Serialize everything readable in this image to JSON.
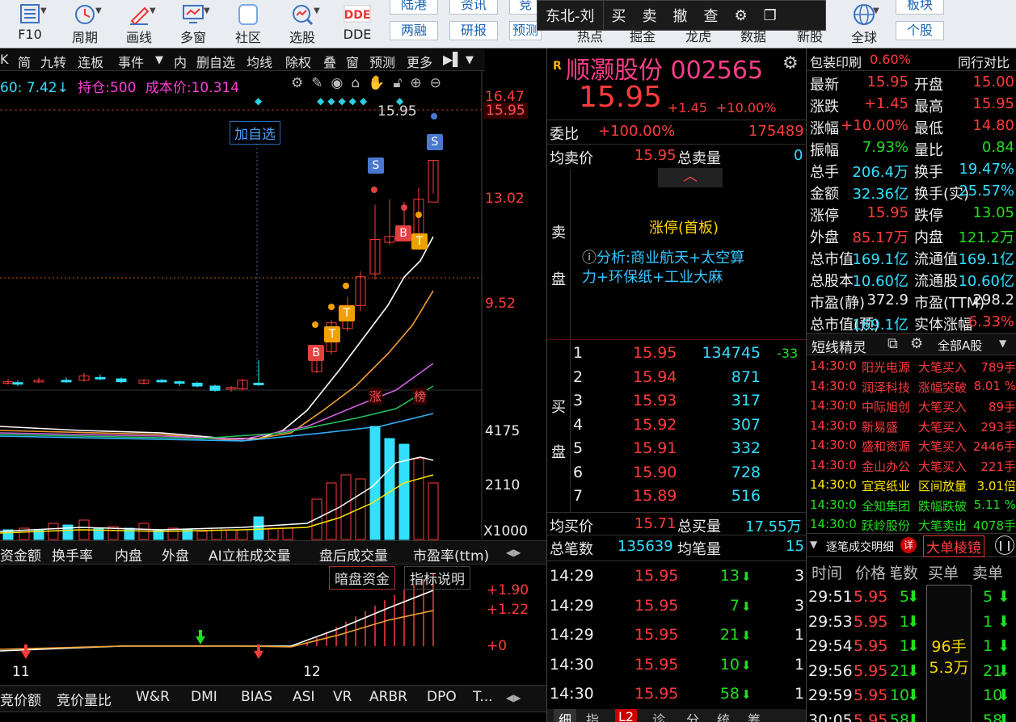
{
  "toolbar": {
    "buttons": [
      {
        "label": "F10",
        "icon": "f10-icon"
      },
      {
        "label": "周期",
        "icon": "clock-icon"
      },
      {
        "label": "画线",
        "icon": "pencil-icon"
      },
      {
        "label": "多窗",
        "icon": "monitor-icon"
      },
      {
        "label": "社区",
        "icon": "community-icon"
      },
      {
        "label": "选股",
        "icon": "stock-search-icon"
      },
      {
        "label": "DDE",
        "icon": "dde-icon"
      }
    ],
    "small_buttons": [
      "陆港",
      "资讯",
      "竞",
      "两融",
      "研报",
      "预测"
    ],
    "right_labels": [
      "热点",
      "掘金",
      "龙虎",
      "数据",
      "新股"
    ],
    "globe_label": "全球",
    "right_small": [
      "板块",
      "个股"
    ],
    "popup": {
      "account": "东北-刘",
      "buy": "买",
      "sell": "卖",
      "cancel": "撤",
      "query": "查"
    }
  },
  "left_menu": [
    "K",
    "简",
    "九转",
    "连板",
    "事件",
    "▼",
    "内",
    "删自选",
    "均线",
    "除权",
    "叠",
    "窗",
    "预测",
    "更多"
  ],
  "kline": {
    "ma_label": "60: 7.42↓",
    "position_label": "持仓:500",
    "cost_label": "成本价:10.314",
    "y_ticks": [
      "16.47",
      "15.95",
      "13.02",
      "9.52"
    ],
    "last_price": "15.95",
    "add_watch": "加自选",
    "markers": {
      "buy": "B",
      "sell": "S",
      "t": "T"
    },
    "tags": [
      "涨",
      "榜"
    ]
  },
  "volume": {
    "y_ticks": [
      "4175",
      "2110",
      "X1000"
    ],
    "bars_red": [
      120,
      105,
      140,
      125,
      110,
      95,
      115,
      120,
      135,
      90,
      75,
      100,
      85,
      70,
      145,
      80,
      92,
      90,
      90,
      130,
      330,
      330,
      415,
      425,
      440,
      450
    ],
    "bars_cyan": [
      0,
      0,
      0,
      0,
      0,
      0,
      0,
      0,
      0,
      0,
      0,
      0,
      0,
      0,
      0,
      0,
      0,
      0,
      0,
      0,
      0,
      0,
      0,
      0,
      0,
      0
    ]
  },
  "indicator_tabs": [
    "资金额",
    "换手率",
    "内盘",
    "外盘",
    "AI立桩成交量",
    "盘后成交量",
    "市盈率(ttm)"
  ],
  "lower": {
    "buttons": [
      "暗盘资金",
      "指标说明"
    ],
    "y_ticks": [
      "+1.90",
      "+1.22",
      "+0"
    ],
    "x_labels": [
      "11",
      "12"
    ]
  },
  "bottom_tabs": [
    "竞价额",
    "竞价量比",
    "W&R",
    "DMI",
    "BIAS",
    "ASI",
    "VR",
    "ARBR",
    "DPO",
    "T..."
  ],
  "quote": {
    "badge": "R",
    "name": "顺灏股份",
    "code": "002565",
    "price": "15.95",
    "change": "+1.45",
    "pct": "+10.00%",
    "weibi_label": "委比",
    "weibi": "+100.00%",
    "weibi_amt": "175489",
    "avg_sell_label": "均卖价",
    "avg_sell": "15.95",
    "total_sell_label": "总卖量",
    "total_sell": "0",
    "sell_side": "卖",
    "sell_side2": "盘",
    "limit_up": "涨停(首板)",
    "analysis": "分析:商业航天+太空算力+环保纸+工业大麻",
    "buy_side": "买",
    "buy_side2": "盘",
    "bids": [
      {
        "lvl": "1",
        "price": "15.95",
        "vol": "134745",
        "chg": "-33"
      },
      {
        "lvl": "2",
        "price": "15.94",
        "vol": "871",
        "chg": ""
      },
      {
        "lvl": "3",
        "price": "15.93",
        "vol": "317",
        "chg": ""
      },
      {
        "lvl": "4",
        "price": "15.92",
        "vol": "307",
        "chg": ""
      },
      {
        "lvl": "5",
        "price": "15.91",
        "vol": "332",
        "chg": ""
      },
      {
        "lvl": "6",
        "price": "15.90",
        "vol": "728",
        "chg": ""
      },
      {
        "lvl": "7",
        "price": "15.89",
        "vol": "516",
        "chg": ""
      }
    ],
    "avg_buy_label": "均买价",
    "avg_buy": "15.71",
    "total_buy_label": "总买量",
    "total_buy": "17.55万",
    "total_trades_label": "总笔数",
    "total_trades": "135639",
    "avg_trade_label": "均笔量",
    "avg_trade": "15",
    "ticks": [
      {
        "time": "14:29",
        "price": "15.95",
        "vol": "13",
        "n": "3"
      },
      {
        "time": "14:29",
        "price": "15.95",
        "vol": "7",
        "n": "3"
      },
      {
        "time": "14:29",
        "price": "15.95",
        "vol": "21",
        "n": "1"
      },
      {
        "time": "14:30",
        "price": "15.95",
        "vol": "10",
        "n": "1"
      },
      {
        "time": "14:30",
        "price": "15.95",
        "vol": "58",
        "n": "1"
      }
    ],
    "bottom_tabs": [
      "细",
      "指",
      "L2",
      "诊",
      "分",
      "统",
      "筹"
    ]
  },
  "stats": {
    "header": {
      "left": "包装印刷",
      "left_pct": "0.60%",
      "right": "同行对比"
    },
    "rows": [
      {
        "l": "最新",
        "lv": "15.95",
        "r": "开盘",
        "rv": "15.00",
        "lc": "red",
        "rc": "red"
      },
      {
        "l": "涨跌",
        "lv": "+1.45",
        "r": "最高",
        "rv": "15.95",
        "lc": "red",
        "rc": "red"
      },
      {
        "l": "涨幅",
        "lv": "+10.00%",
        "r": "最低",
        "rv": "14.80",
        "lc": "red",
        "rc": "red"
      },
      {
        "l": "振幅",
        "lv": "7.93%",
        "r": "量比",
        "rv": "0.84",
        "lc": "green",
        "rc": "green"
      },
      {
        "l": "总手",
        "lv": "206.4万",
        "r": "换手",
        "rv": "19.47%",
        "lc": "cyan",
        "rc": "cyan"
      },
      {
        "l": "金额",
        "lv": "32.36亿",
        "r": "换手(实)",
        "rv": "25.57%",
        "lc": "cyan",
        "rc": "cyan"
      },
      {
        "l": "涨停",
        "lv": "15.95",
        "r": "跌停",
        "rv": "13.05",
        "lc": "red",
        "rc": "green"
      },
      {
        "l": "外盘",
        "lv": "85.17万",
        "r": "内盘",
        "rv": "121.2万",
        "lc": "red",
        "rc": "green"
      },
      {
        "l": "总市值",
        "lv": "169.1亿",
        "r": "流通值",
        "rv": "169.1亿",
        "lc": "cyan",
        "rc": "cyan"
      },
      {
        "l": "总股本",
        "lv": "10.60亿",
        "r": "流通股",
        "rv": "10.60亿",
        "lc": "cyan",
        "rc": "cyan"
      },
      {
        "l": "市盈(静)",
        "lv": "372.9",
        "r": "市盈(TTM)",
        "rv": "298.2",
        "lc": "white",
        "rc": "white"
      },
      {
        "l": "总市值(预)",
        "lv": "169.1亿",
        "r": "实体涨幅",
        "rv": "6.33%",
        "lc": "cyan",
        "rc": "red"
      }
    ]
  },
  "sprite": {
    "title": "短线精灵",
    "filter": "全部A股",
    "rows": [
      {
        "t": "14:30:0",
        "name": "阳光电源",
        "ev": "大笔买入",
        "v": "789手",
        "c": "red"
      },
      {
        "t": "14:30:0",
        "name": "润泽科技",
        "ev": "涨幅突破",
        "v": "8.01 %",
        "c": "red"
      },
      {
        "t": "14:30:0",
        "name": "中际旭创",
        "ev": "大笔买入",
        "v": "89手",
        "c": "red"
      },
      {
        "t": "14:30:0",
        "name": "新易盛",
        "ev": "大笔买入",
        "v": "293手",
        "c": "red"
      },
      {
        "t": "14:30:0",
        "name": "盛和资源",
        "ev": "大笔买入",
        "v": "2446手",
        "c": "red"
      },
      {
        "t": "14:30:0",
        "name": "金山办公",
        "ev": "大笔买入",
        "v": "221手",
        "c": "red"
      },
      {
        "t": "14:30:0",
        "name": "宜宾纸业",
        "ev": "区间放量",
        "v": "3.01倍",
        "c": "yellow"
      },
      {
        "t": "14:30:0",
        "name": "全知集团",
        "ev": "跌幅跌破",
        "v": "5.11 %",
        "c": "green"
      },
      {
        "t": "14:30:0",
        "name": "跃岭股份",
        "ev": "大笔卖出",
        "v": "4078手",
        "c": "green"
      }
    ]
  },
  "bigorder": {
    "tab": "逐笔成交明细",
    "badge": "详",
    "active": "大单棱镜",
    "headers": [
      "时间",
      "价格",
      "笔数",
      "买单",
      "卖单"
    ],
    "rows": [
      {
        "t": "29:51",
        "p": "5.95",
        "n": "5",
        "s": "5"
      },
      {
        "t": "29:53",
        "p": "5.95",
        "n": "1",
        "s": "1"
      },
      {
        "t": "29:54",
        "p": "5.95",
        "n": "1",
        "s": "1"
      },
      {
        "t": "29:56",
        "p": "5.95",
        "n": "21",
        "s": "21"
      },
      {
        "t": "29:59",
        "p": "5.95",
        "n": "10",
        "s": "10"
      },
      {
        "t": "30:05",
        "p": "5.95",
        "n": "58",
        "s": "58"
      }
    ],
    "buy_hand": "96手",
    "buy_amt": "5.3万"
  }
}
